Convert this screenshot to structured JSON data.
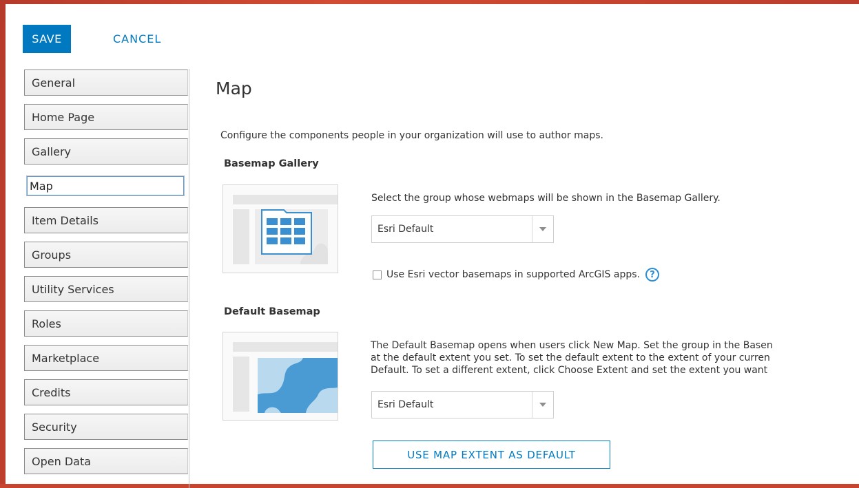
{
  "toolbar": {
    "save_label": "SAVE",
    "cancel_label": "CANCEL"
  },
  "nav": {
    "items": [
      {
        "label": "General"
      },
      {
        "label": "Home Page"
      },
      {
        "label": "Gallery"
      },
      {
        "label": "Map",
        "active": true
      },
      {
        "label": "Item Details"
      },
      {
        "label": "Groups"
      },
      {
        "label": "Utility Services"
      },
      {
        "label": "Roles"
      },
      {
        "label": "Marketplace"
      },
      {
        "label": "Credits"
      },
      {
        "label": "Security"
      },
      {
        "label": "Open Data"
      }
    ]
  },
  "main": {
    "title": "Map",
    "intro": "Configure the components people in your organization will use to author maps.",
    "basemap_gallery": {
      "heading": "Basemap Gallery",
      "description": "Select the group whose webmaps will be shown in the Basemap Gallery.",
      "select_value": "Esri Default",
      "checkbox_label": "Use Esri vector basemaps in supported ArcGIS apps.",
      "checkbox_checked": false,
      "help_glyph": "?"
    },
    "default_basemap": {
      "heading": "Default Basemap",
      "description_lines": [
        "The Default Basemap opens when users click New Map. Set the group in the Basen",
        "at the default extent you set. To set the default extent to the extent of your curren",
        "Default. To set a different extent, click Choose Extent and set the extent you want"
      ],
      "select_value": "Esri Default",
      "extent_button_label": "USE MAP EXTENT AS DEFAULT"
    }
  },
  "colors": {
    "accent": "#0079c1",
    "background_red": "#c8442f",
    "map_blue": "#4a9ad4",
    "map_light_blue": "#b9d9ee"
  },
  "icons": {
    "select_arrow": "chevron-down-icon",
    "help": "question-circle-icon"
  }
}
